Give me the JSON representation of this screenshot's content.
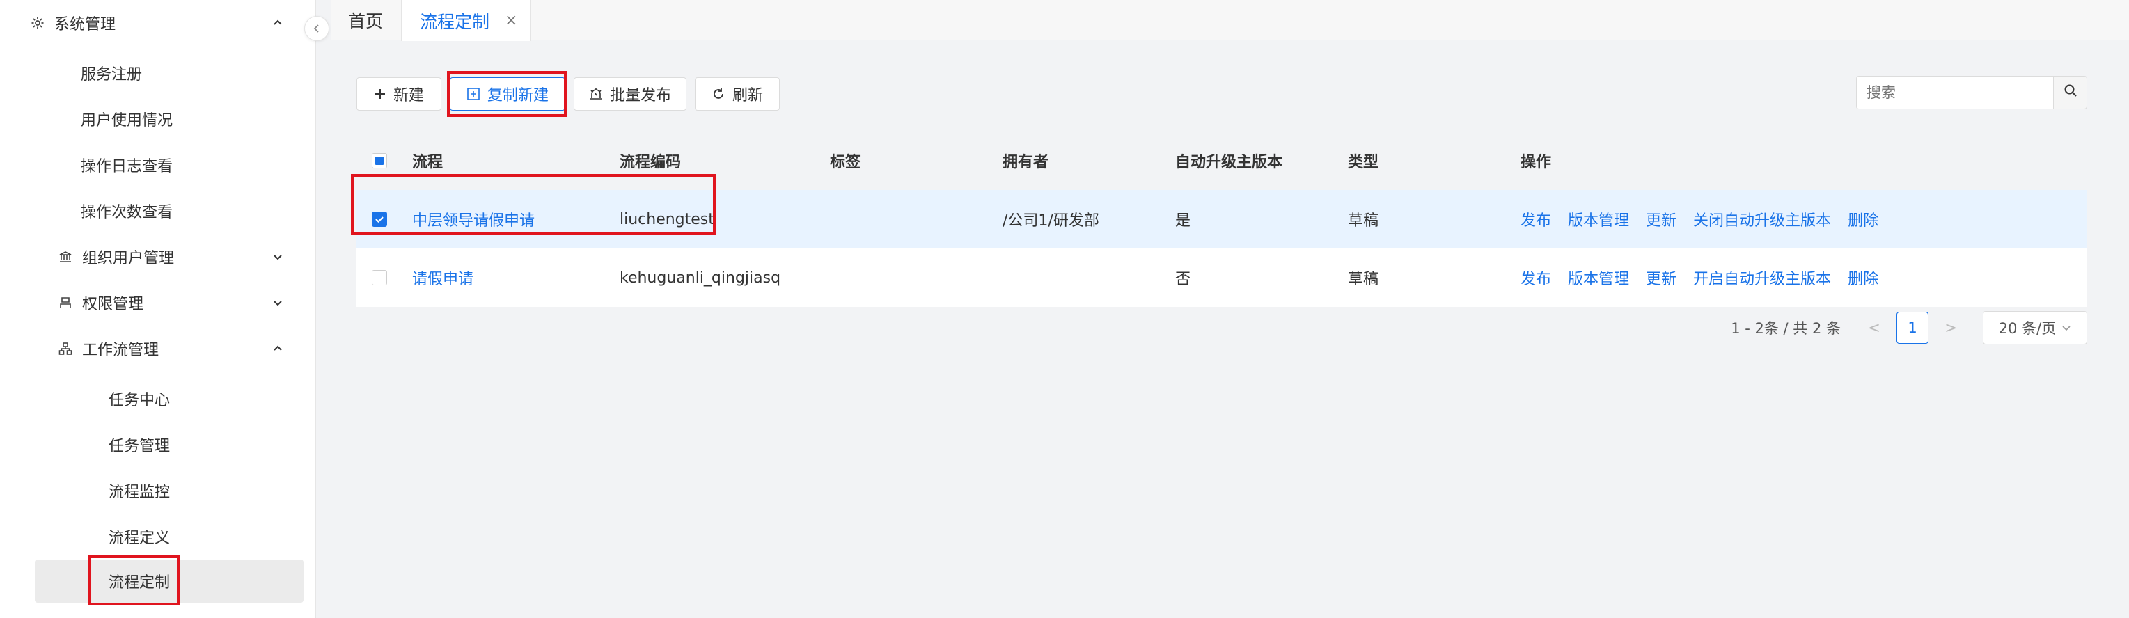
{
  "sidebar": {
    "items": [
      {
        "label": "系统管理",
        "icon": "gear-icon",
        "level": 0,
        "expanded": true
      },
      {
        "label": "服务注册",
        "level": 1
      },
      {
        "label": "用户使用情况",
        "level": 1
      },
      {
        "label": "操作日志查看",
        "level": 1
      },
      {
        "label": "操作次数查看",
        "level": 1
      },
      {
        "label": "组织用户管理",
        "icon": "bank-icon",
        "level": 1,
        "expanded": false
      },
      {
        "label": "权限管理",
        "icon": "user-icon",
        "level": 1,
        "expanded": false
      },
      {
        "label": "工作流管理",
        "icon": "flow-icon",
        "level": 1,
        "expanded": true
      },
      {
        "label": "任务中心",
        "level": 2
      },
      {
        "label": "任务管理",
        "level": 2
      },
      {
        "label": "流程监控",
        "level": 2
      },
      {
        "label": "流程定义",
        "level": 2
      },
      {
        "label": "流程定制",
        "level": 2,
        "active": true
      }
    ]
  },
  "tabs": {
    "home": "首页",
    "active": "流程定制",
    "close": "×"
  },
  "toolbar": {
    "new_label": "新建",
    "copy_new_label": "复制新建",
    "batch_publish_label": "批量发布",
    "refresh_label": "刷新"
  },
  "search": {
    "placeholder": "搜索"
  },
  "table": {
    "headers": [
      "流程",
      "流程编码",
      "标签",
      "拥有者",
      "自动升级主版本",
      "类型",
      "操作"
    ],
    "rows": [
      {
        "name": "中层领导请假申请",
        "code": "liuchengtest",
        "tag": "",
        "owner": "/公司1/研发部",
        "auto_upgrade": "是",
        "type": "草稿",
        "ops": [
          "发布",
          "版本管理",
          "更新",
          "关闭自动升级主版本",
          "删除"
        ],
        "checked": true
      },
      {
        "name": "请假申请",
        "code": "kehuguanli_qingjiasq",
        "tag": "",
        "owner": "",
        "auto_upgrade": "否",
        "type": "草稿",
        "ops": [
          "发布",
          "版本管理",
          "更新",
          "开启自动升级主版本",
          "删除"
        ],
        "checked": false
      }
    ]
  },
  "pagination": {
    "info": "1 - 2条 / 共 2 条",
    "current_page": "1",
    "page_size": "20 条/页"
  },
  "colors": {
    "accent": "#1a73e8",
    "highlight": "#e0141e",
    "selected_row": "#e8f3ff"
  }
}
